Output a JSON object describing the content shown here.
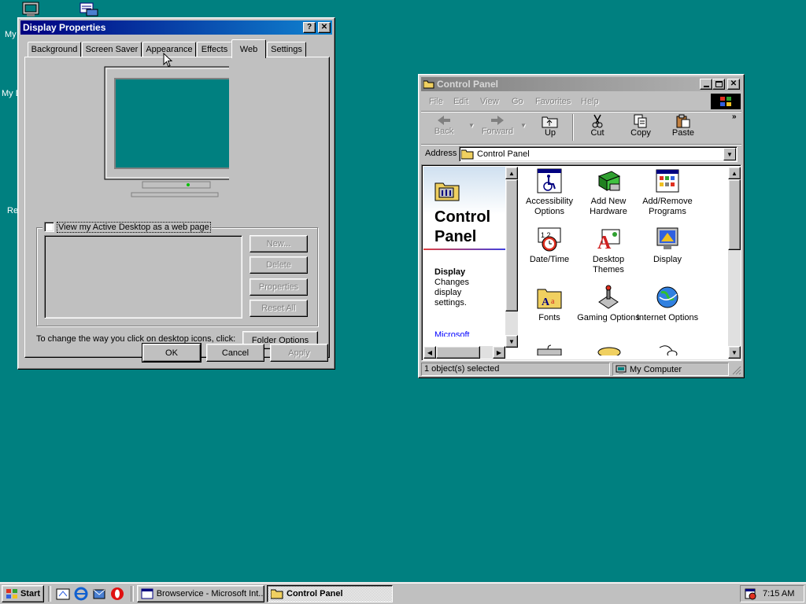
{
  "desktop": {
    "labels": [
      "My",
      "My D",
      "Re"
    ]
  },
  "display_props": {
    "title": "Display Properties",
    "help_glyph": "?",
    "close_glyph": "✕",
    "tabs": [
      "Background",
      "Screen Saver",
      "Appearance",
      "Effects",
      "Web",
      "Settings"
    ],
    "active_tab": "Web",
    "checkbox_label": "View my Active Desktop as a web page",
    "buttons": {
      "new": "New...",
      "delete": "Delete",
      "properties": "Properties",
      "reset": "Reset All"
    },
    "click_text": "To change the way you click on desktop icons, click:",
    "folder_options": "Folder Options",
    "ok": "OK",
    "cancel": "Cancel",
    "apply": "Apply",
    "monitor_color": "#008080"
  },
  "control_panel": {
    "title": "Control Panel",
    "menu": [
      "File",
      "Edit",
      "View",
      "Go",
      "Favorites",
      "Help"
    ],
    "toolbar": {
      "back": "Back",
      "forward": "Forward",
      "up": "Up",
      "cut": "Cut",
      "copy": "Copy",
      "paste": "Paste"
    },
    "address_label": "Address",
    "address_value": "Control Panel",
    "side": {
      "heading": "Control Panel",
      "item_title": "Display",
      "item_desc": "Changes display settings.",
      "link": "Microsoft Home"
    },
    "icons": [
      {
        "label": "Accessibility Options",
        "icon": "wheelchair-icon"
      },
      {
        "label": "Add New Hardware",
        "icon": "hardware-icon"
      },
      {
        "label": "Add/Remove Programs",
        "icon": "programs-icon"
      },
      {
        "label": "Date/Time",
        "icon": "clock-icon"
      },
      {
        "label": "Desktop Themes",
        "icon": "themes-icon"
      },
      {
        "label": "Display",
        "icon": "monitor-icon"
      },
      {
        "label": "Fonts",
        "icon": "fonts-folder-icon"
      },
      {
        "label": "Gaming Options",
        "icon": "joystick-icon"
      },
      {
        "label": "Internet Options",
        "icon": "globe-icon"
      }
    ],
    "status_left": "1 object(s) selected",
    "status_right": "My Computer"
  },
  "taskbar": {
    "start": "Start",
    "tasks": [
      "Browservice - Microsoft Int...",
      "Control Panel"
    ],
    "active_task": "Control Panel",
    "clock": "7:15 AM"
  }
}
